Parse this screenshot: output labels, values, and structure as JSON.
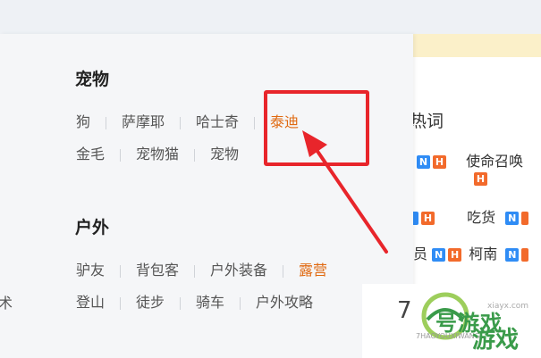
{
  "sections": {
    "pets": {
      "title": "宠物",
      "row1": [
        "狗",
        "萨摩耶",
        "哈士奇",
        "泰迪"
      ],
      "row2": [
        "金毛",
        "宠物猫",
        "宠物"
      ]
    },
    "outdoor": {
      "title": "户外",
      "row1": [
        "驴友",
        "背包客",
        "户外装备",
        "露营"
      ],
      "row2": [
        "登山",
        "徒步",
        "骑车",
        "户外攻略"
      ]
    }
  },
  "left_cut_text": "术",
  "hot": {
    "title_fragment": "热词",
    "rows": [
      {
        "prefix": "",
        "text": "使命召唤"
      },
      {
        "prefix": "",
        "text": "吃货"
      },
      {
        "prefix": "员",
        "text": "柯南"
      }
    ],
    "badge_n": "N",
    "badge_h": "H"
  },
  "watermark": {
    "digit": "7",
    "name": "游戏",
    "brand": "号游戏",
    "pinyin": "7HAOYOUXIWANG",
    "url": "xiayx.com"
  },
  "colors": {
    "accent": "#e06a12",
    "highlight": "#e8252b",
    "badge_n": "#2f8cf5",
    "badge_h": "#f26a2b"
  }
}
